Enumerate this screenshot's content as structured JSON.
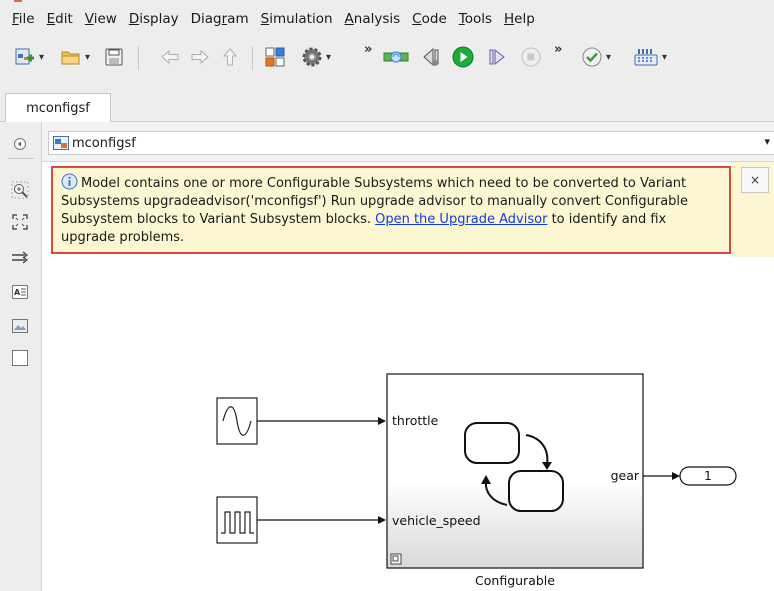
{
  "menubar": {
    "items": [
      {
        "label": "File",
        "mnemonic": "F",
        "rest": "ile"
      },
      {
        "label": "Edit",
        "mnemonic": "E",
        "rest": "dit"
      },
      {
        "label": "View",
        "mnemonic": "V",
        "rest": "iew"
      },
      {
        "label": "Display",
        "mnemonic": "D",
        "rest": "isplay"
      },
      {
        "label": "Diagram",
        "pre": "Diag",
        "mnemonic": "r",
        "rest": "am"
      },
      {
        "label": "Simulation",
        "mnemonic": "S",
        "rest": "imulation"
      },
      {
        "label": "Analysis",
        "mnemonic": "A",
        "rest": "nalysis"
      },
      {
        "label": "Code",
        "mnemonic": "C",
        "rest": "ode"
      },
      {
        "label": "Tools",
        "mnemonic": "T",
        "rest": "ools"
      },
      {
        "label": "Help",
        "mnemonic": "H",
        "rest": "elp"
      }
    ]
  },
  "toolbar": {
    "overflow_glyph": "»",
    "dropdown_glyph": "▾",
    "icons": [
      "new-model-icon",
      "open-folder-icon",
      "save-icon",
      "back-arrow-icon",
      "forward-arrow-icon",
      "up-arrow-icon",
      "library-browser-icon",
      "model-settings-gear-icon",
      "model-explorer-icon",
      "step-back-icon",
      "run-icon",
      "step-forward-icon",
      "stop-icon",
      "model-advisor-check-icon",
      "build-icon"
    ]
  },
  "tab": {
    "label": "mconfigsf"
  },
  "address": {
    "model_name": "mconfigsf",
    "dropdown_glyph": "▾"
  },
  "banner": {
    "text_before_link": "Model contains one or more Configurable Subsystems which need to be converted to Variant Subsystems upgradeadvisor('mconfigsf') Run upgrade advisor to manually convert Configurable Subsystem blocks to Variant Subsystem blocks. ",
    "link_text": "Open the Upgrade Advisor",
    "text_after_link": " to identify and fix upgrade problems.",
    "close_glyph": "×"
  },
  "diagram": {
    "subsystem_name": "Configurable",
    "input_ports": [
      "throttle",
      "vehicle_speed"
    ],
    "output_port": "gear",
    "outport_number": "1",
    "sources": [
      "sine-wave-source",
      "pulse-generator-source"
    ]
  },
  "colors": {
    "chrome": "#ededed",
    "banner_bg": "#fdf6d2",
    "banner_border": "#d84a3a",
    "link": "#0f3ed8",
    "run_green": "#1faa3a"
  }
}
